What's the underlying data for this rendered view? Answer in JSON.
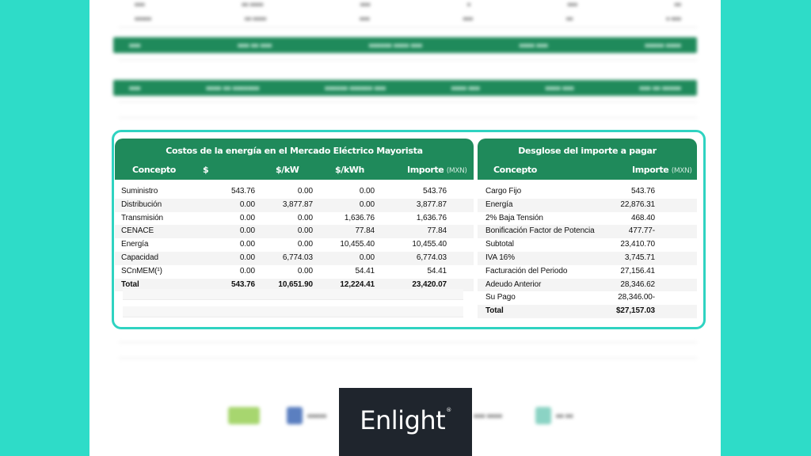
{
  "left_table": {
    "title": "Costos de la energía en el Mercado Eléctrico Mayorista",
    "headers": {
      "concepto": "Concepto",
      "pesos": "$",
      "per_kw": "$/kW",
      "per_kwh": "$/kWh",
      "importe": "Importe",
      "importe_unit": "(MXN)"
    },
    "rows": [
      {
        "concepto": "Suministro",
        "pesos": "543.76",
        "per_kw": "0.00",
        "per_kwh": "0.00",
        "importe": "543.76"
      },
      {
        "concepto": "Distribución",
        "pesos": "0.00",
        "per_kw": "3,877.87",
        "per_kwh": "0.00",
        "importe": "3,877.87"
      },
      {
        "concepto": "Transmisión",
        "pesos": "0.00",
        "per_kw": "0.00",
        "per_kwh": "1,636.76",
        "importe": "1,636.76"
      },
      {
        "concepto": "CENACE",
        "pesos": "0.00",
        "per_kw": "0.00",
        "per_kwh": "77.84",
        "importe": "77.84"
      },
      {
        "concepto": "Energía",
        "pesos": "0.00",
        "per_kw": "0.00",
        "per_kwh": "10,455.40",
        "importe": "10,455.40"
      },
      {
        "concepto": "Capacidad",
        "pesos": "0.00",
        "per_kw": "6,774.03",
        "per_kwh": "0.00",
        "importe": "6,774.03"
      },
      {
        "concepto": "SCnMEM(¹)",
        "pesos": "0.00",
        "per_kw": "0.00",
        "per_kwh": "54.41",
        "importe": "54.41"
      }
    ],
    "total": {
      "concepto": "Total",
      "pesos": "543.76",
      "per_kw": "10,651.90",
      "per_kwh": "12,224.41",
      "importe": "23,420.07"
    }
  },
  "right_table": {
    "title": "Desglose del importe a pagar",
    "headers": {
      "concepto": "Concepto",
      "importe": "Importe",
      "importe_unit": "(MXN)"
    },
    "rows": [
      {
        "concepto": "Cargo Fijo",
        "importe": "543.76"
      },
      {
        "concepto": "Energía",
        "importe": "22,876.31"
      },
      {
        "concepto": "2% Baja Tensión",
        "importe": "468.40"
      },
      {
        "concepto": "Bonificación Factor de Potencia",
        "importe": "477.77-"
      },
      {
        "concepto": "Subtotal",
        "importe": "23,410.70"
      },
      {
        "concepto": "IVA 16%",
        "importe": "3,745.71"
      },
      {
        "concepto": "Facturación del Periodo",
        "importe": "27,156.41"
      },
      {
        "concepto": "Adeudo Anterior",
        "importe": "28,346.62"
      },
      {
        "concepto": "Su Pago",
        "importe": "28,346.00-"
      }
    ],
    "total": {
      "concepto": "Total",
      "importe": "$27,157.03"
    }
  },
  "brand": {
    "logo_text": "Enlight",
    "registered_mark": "®"
  },
  "colors": {
    "background": "#2edcc8",
    "header_green": "#1f8a5b",
    "highlight_border": "#2fd3c1",
    "logo_bg": "#1f252d"
  }
}
